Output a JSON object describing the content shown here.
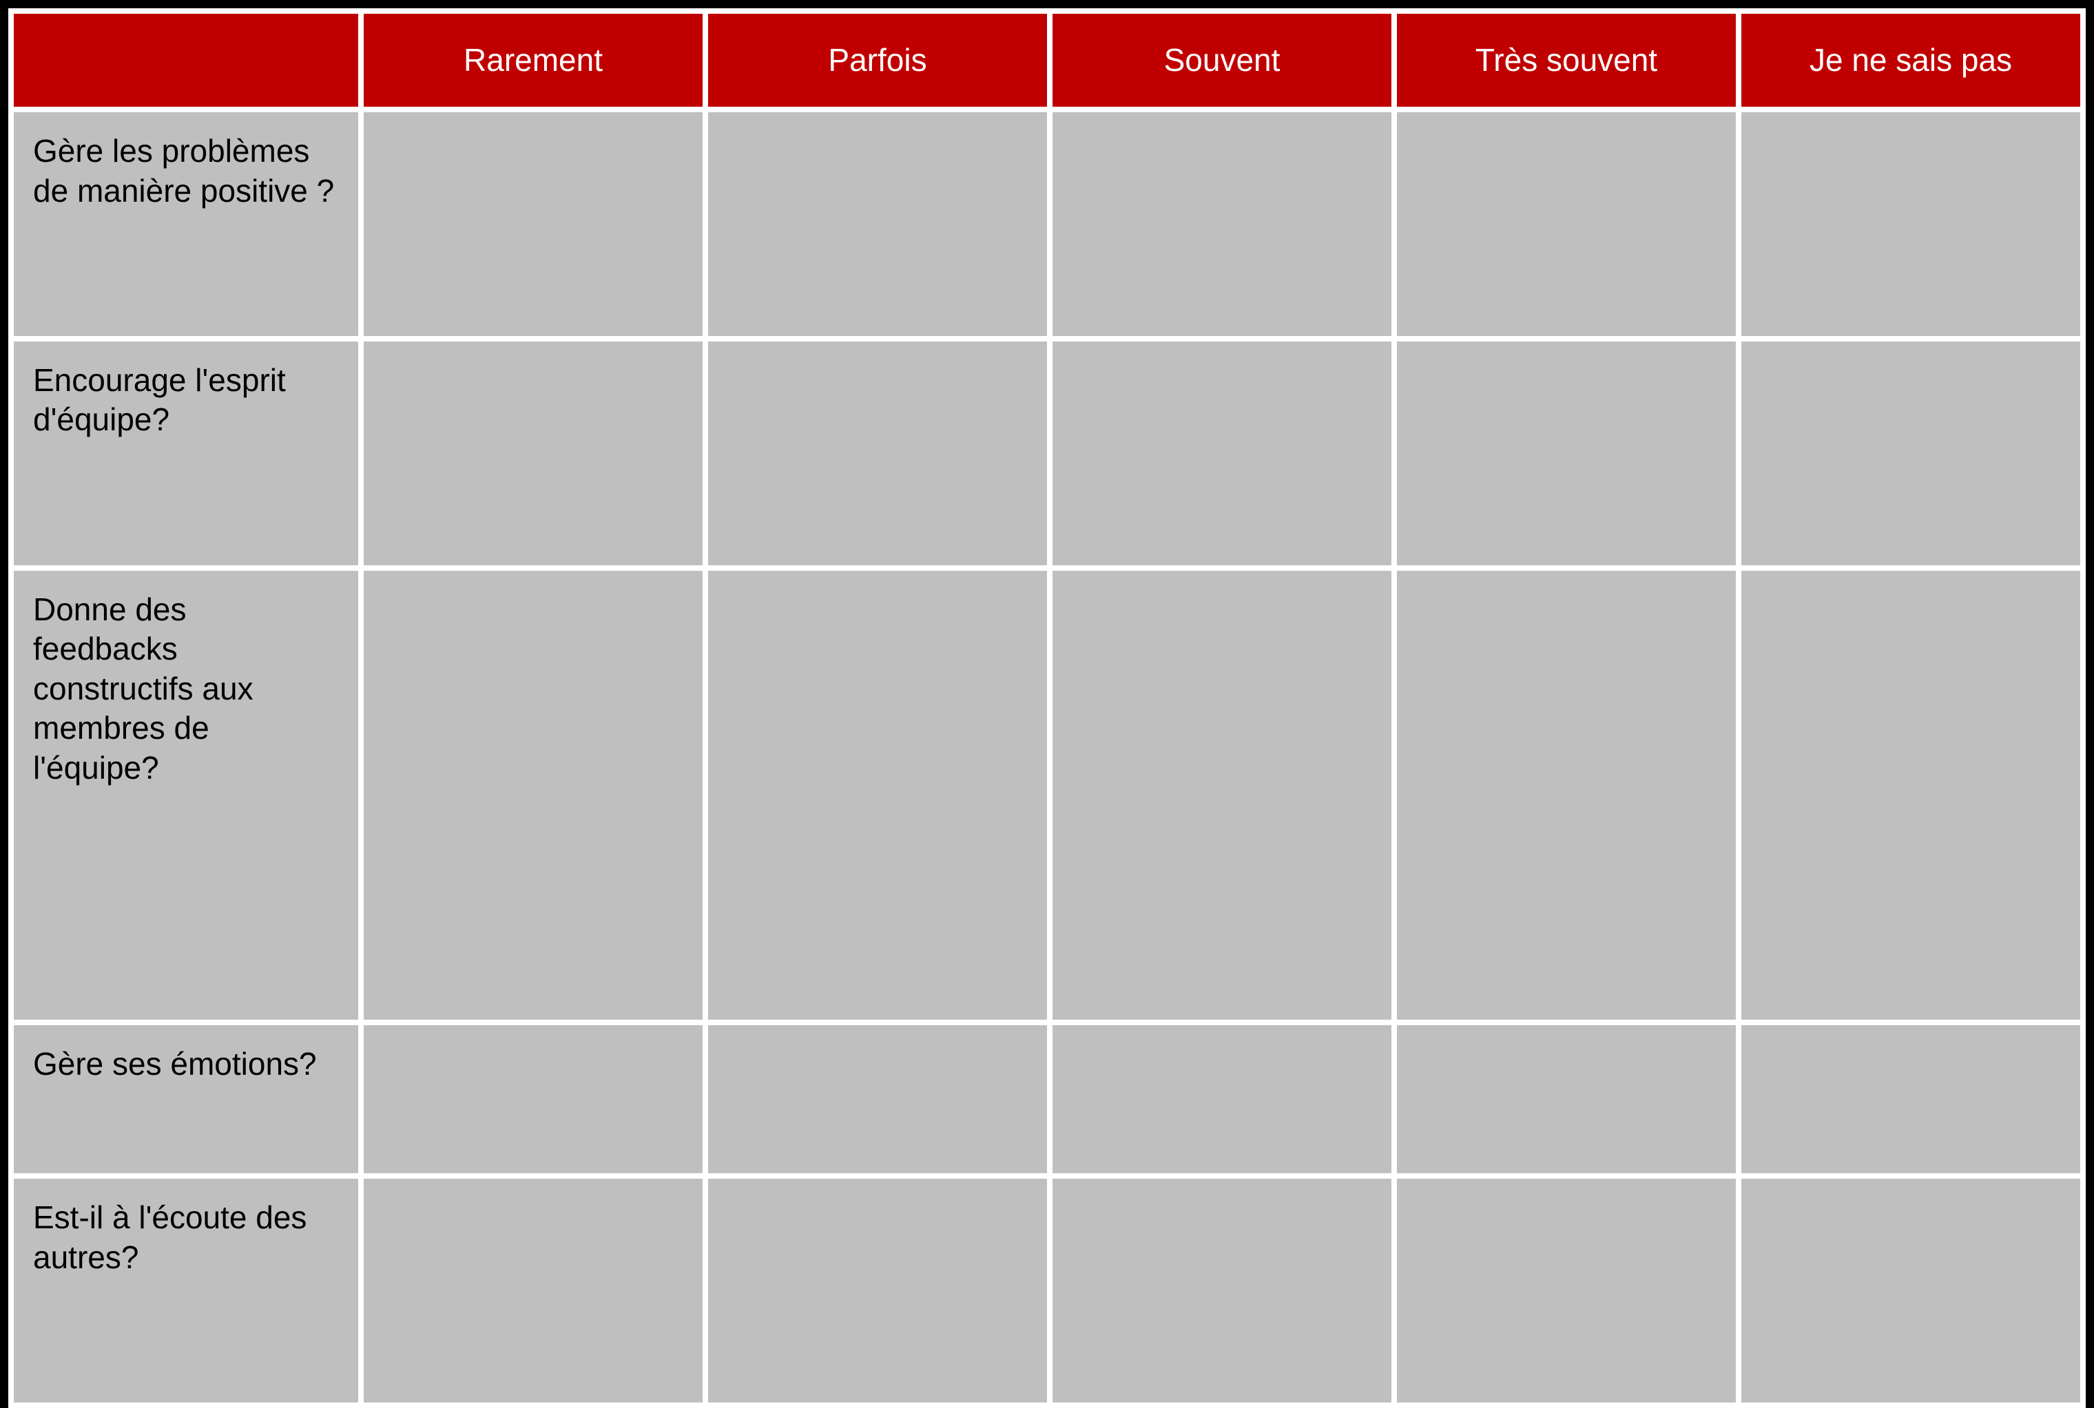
{
  "colors": {
    "header_bg": "#c00000",
    "header_text": "#ffffff",
    "cell_bg": "#bfbfbf",
    "cell_text": "#000000",
    "page_bg": "#000000"
  },
  "table": {
    "columns": [
      "Rarement",
      "Parfois",
      "Souvent",
      "Très souvent",
      "Je ne sais pas"
    ],
    "rows": [
      "Gère les problèmes de manière positive ?",
      "Encourage l'esprit d'équipe?",
      "Donne des feedbacks constructifs aux membres de l'équipe?",
      "Gère ses émotions?",
      "Est-il à l'écoute des autres?"
    ]
  }
}
